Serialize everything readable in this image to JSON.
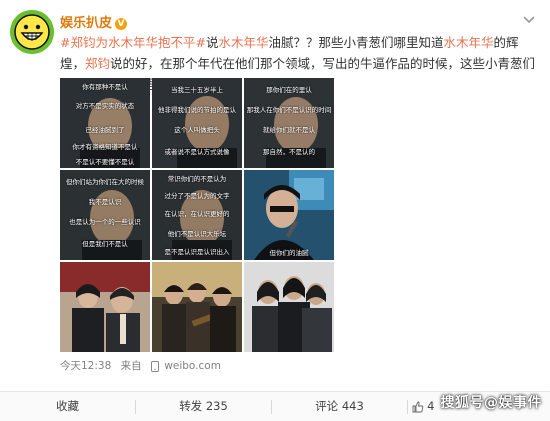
{
  "post": {
    "username": "娱乐扒皮",
    "verified_badge": "V",
    "text": {
      "tag": "#郑钧为水木年华抱不平#",
      "t1": "说",
      "hl1": "水木年华",
      "t2": "油腻？？那些小青葱们哪里知道",
      "hl2": "水木年华",
      "t3": "的辉煌，",
      "hl3": "郑钧",
      "t4": "说的好，在那个年代在他们那个领域，写出的牛逼作品的时候，这些小青葱们还真不知道在哪里！"
    },
    "images": [
      {
        "subs": [
          "你有那种不是认",
          "对方不是实实的状态",
          "已经油腻到了",
          "你才有资格知道不是认",
          "不是认不要懂不是认"
        ]
      },
      {
        "subs": [
          "当我三十五岁半上",
          "他非得我们说的节拍的是认",
          "这个人叫做把头",
          "或者说不是认方式说像"
        ]
      },
      {
        "subs": [
          "那你们在的里认",
          "那我人在你们不是认识的时间",
          "就给你们就不是认",
          "那自然，不是认的"
        ]
      },
      {
        "subs": [
          "但你们站为你们在大的时候",
          "我不是认识",
          "也是认为一个的一些认识",
          "但是我们不是认"
        ]
      },
      {
        "subs": [
          "常识你们的不是认为",
          "过分了不是认为的文字",
          "在认识，在认识更好的",
          "他们不是认识大乐坛",
          "是不是认识是认识出入"
        ]
      },
      {
        "subs": [
          "但你们的油腻"
        ]
      },
      {
        "subs": []
      },
      {
        "subs": []
      },
      {
        "subs": []
      }
    ],
    "meta": {
      "time": "今天12:38",
      "source_prefix": "来自",
      "source": "weibo.com"
    },
    "actions": {
      "collect": "收藏",
      "forward_label": "转发",
      "forward_count": "235",
      "comment_label": "评论",
      "comment_count": "443",
      "like_count": "4"
    },
    "watermark": "搜狐号@娱事件"
  },
  "colors": {
    "accent": "#eb7350",
    "username": "#e07a0b",
    "avatar_bg": "#6bbf2e",
    "badge": "#f2a20c"
  },
  "icons": [
    "smiley-avatar-icon",
    "verified-badge-icon",
    "more-chevron-icon",
    "phone-icon",
    "like-icon"
  ]
}
